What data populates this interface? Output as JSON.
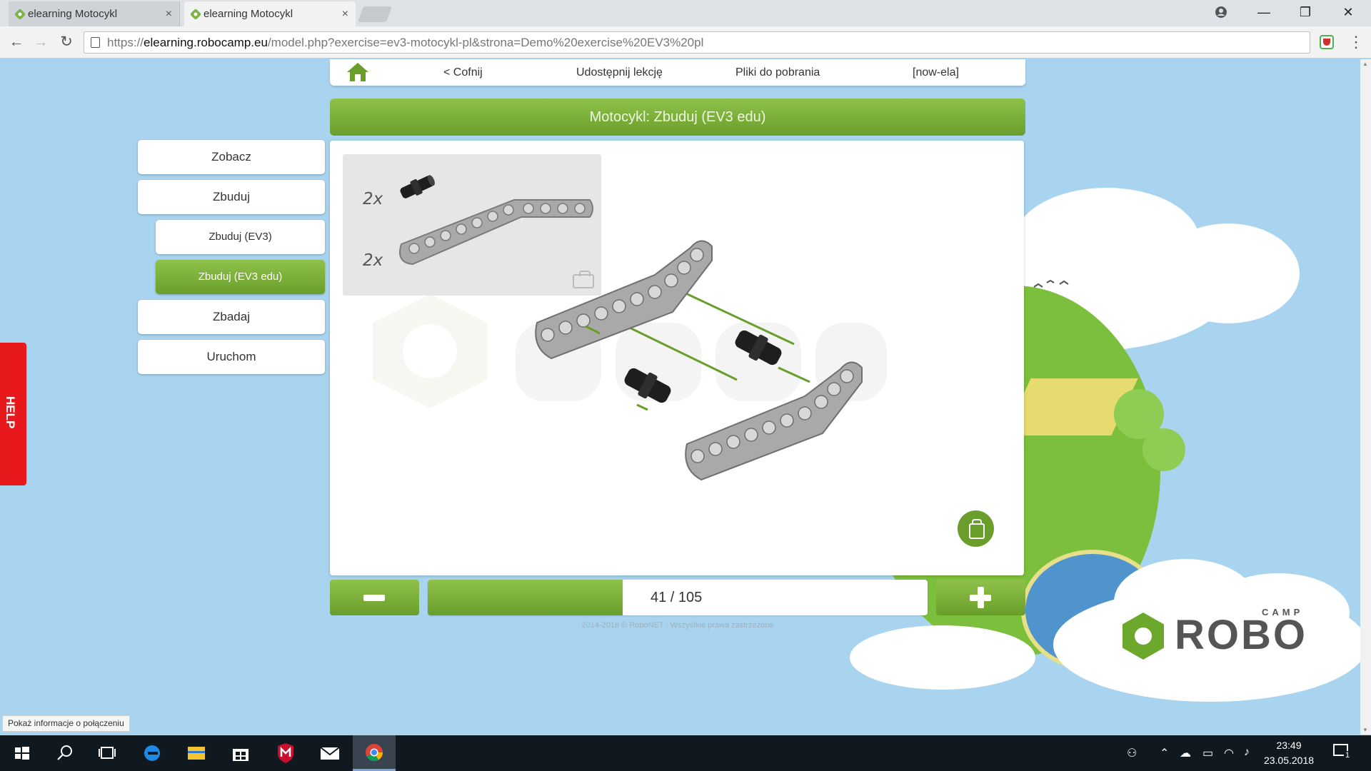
{
  "browser": {
    "tabs": [
      {
        "title": "elearning Motocykl",
        "close": "×"
      },
      {
        "title": "elearning Motocykl",
        "close": "×"
      }
    ],
    "url_scheme": "https://",
    "url_host": "elearning.robocamp.eu",
    "url_path": "/model.php?exercise=ev3-motocykl-pl&strona=Demo%20exercise%20EV3%20pl",
    "window_controls": {
      "minimize": "—",
      "restore": "❐",
      "close": "✕"
    },
    "nav": {
      "back": "←",
      "forward": "→",
      "reload": "↻"
    }
  },
  "topnav": {
    "back_label": "< Cofnij",
    "share_label": "Udostępnij lekcję",
    "downloads_label": "Pliki do pobrania",
    "user_label": "[now-ela]"
  },
  "title": "Motocykl: Zbuduj (EV3 edu)",
  "sidebar": {
    "items": [
      {
        "label": "Zobacz"
      },
      {
        "label": "Zbuduj"
      },
      {
        "label": "Zbuduj (EV3)"
      },
      {
        "label": "Zbuduj (EV3 edu)"
      },
      {
        "label": "Zbadaj"
      },
      {
        "label": "Uruchom"
      }
    ]
  },
  "parts": [
    {
      "qty": "2x"
    },
    {
      "qty": "2x"
    }
  ],
  "pager": {
    "current": 41,
    "total": 105,
    "text": "41 / 105",
    "progress_fraction": 0.39
  },
  "copyright": "2014-2016 © RoboNET : Wszystkie prawa zastrzeżone",
  "help_label": "HELP",
  "logo": {
    "word": "ROBO",
    "camp": "CAMP"
  },
  "status_bubble": "Pokaż informacje o połączeniu",
  "taskbar": {
    "time": "23:49",
    "date": "23.05.2018",
    "notifications": "1"
  },
  "colors": {
    "accent": "#7cb342",
    "help": "#e8191c",
    "background": "#a9d4f0"
  }
}
